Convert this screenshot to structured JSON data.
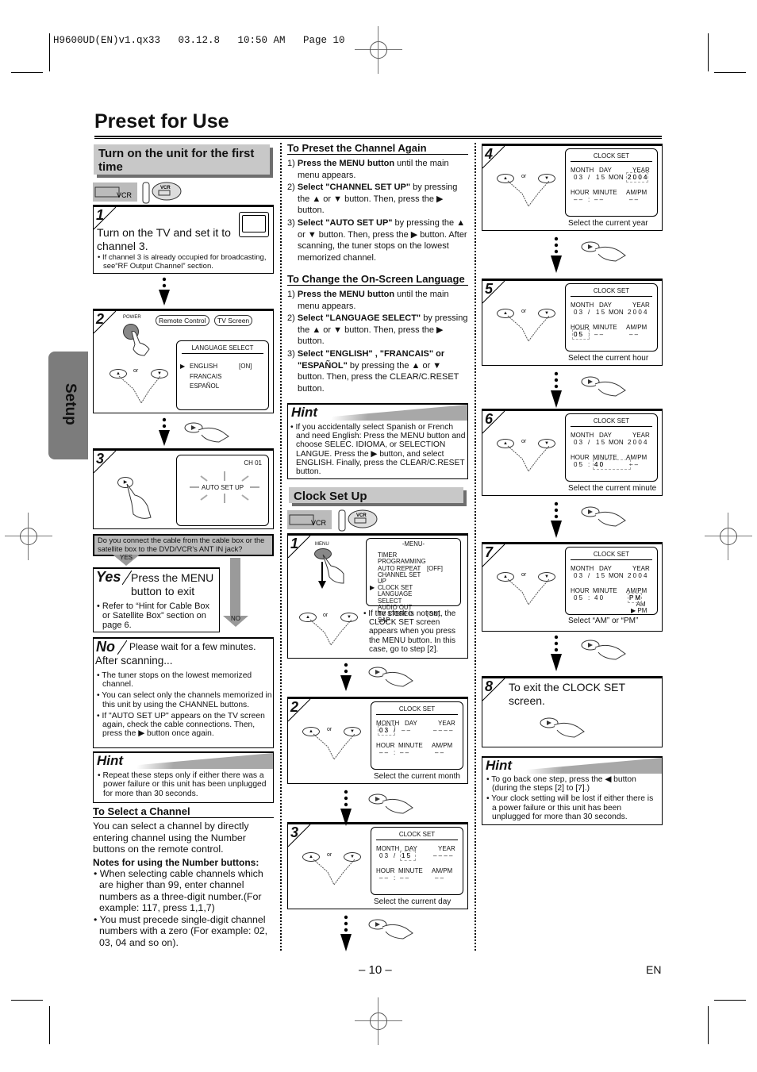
{
  "print_slug": "H9600UD(EN)v1.qx33   03.12.8   10:50 AM   Page 10",
  "page_title": "Preset for Use",
  "side_tab": "Setup",
  "left_col": {
    "section_title": "Turn on the unit for the first time",
    "mode_icons": [
      "vcr-button-icon",
      "remote-vcr-icon"
    ],
    "step1": {
      "num": "1",
      "text": "Turn on the TV and set it to channel 3.",
      "note": "If channel 3 is already occupied for broadcasting, see“RF Output Channel” section."
    },
    "step2": {
      "num": "2",
      "power_label": "POWER",
      "bubble_remote": "Remote Control",
      "bubble_tv": "TV Screen",
      "or": "or",
      "screen_title": "LANGUAGE SELECT",
      "screen_items": [
        {
          "label": "ENGLISH",
          "value": "[ON]",
          "selected": true
        },
        {
          "label": "FRANCAIS",
          "value": "",
          "selected": false
        },
        {
          "label": "ESPAÑOL",
          "value": "",
          "selected": false
        }
      ]
    },
    "step3": {
      "num": "3",
      "channel": "CH 01",
      "screen_text": "AUTO SET UP"
    },
    "question": "Do you connect the cable from the cable box or the satellite box to the DVD/VCR's ANT IN jack?",
    "yes_label": "YES",
    "no_label": "NO",
    "yes_box": {
      "head": "Yes",
      "text": "Press the MENU button to exit",
      "note": "Refer to “Hint for Cable Box or Satellite Box” section on page 6."
    },
    "no_box": {
      "head": "No",
      "text": "Please wait for a few minutes.",
      "after": "After scanning...",
      "notes": [
        "The tuner stops on the lowest memorized channel.",
        "You can select only the channels memorized in this unit by using the CHANNEL buttons.",
        "If \"AUTO SET UP\" appears on the TV screen again, check the cable connections. Then, press the ▶ button once again."
      ]
    },
    "hint": {
      "head": "Hint",
      "notes": [
        "Repeat these steps only if either there was a power failure or this unit has been unplugged for more than 30 seconds."
      ]
    },
    "select_channel": {
      "title": "To Select a Channel",
      "body": "You can select a channel by directly entering channel using the Number buttons on the remote control.",
      "notes_title": "Notes for using the Number buttons:",
      "notes": [
        "When selecting cable channels which are higher than 99, enter channel numbers as a three-digit number.(For example: 117, press 1,1,7)",
        "You must precede single-digit channel numbers with a zero (For example: 02, 03, 04 and so on)."
      ]
    }
  },
  "mid_col": {
    "preset_again": {
      "title": "To Preset the Channel Again",
      "steps": [
        {
          "n": "1)",
          "bold": "Press the MENU button",
          "rest": " until the main menu appears."
        },
        {
          "n": "2)",
          "bold": "Select \"CHANNEL SET UP\"",
          "rest": " by pressing the ▲ or ▼ button. Then, press the ▶ button."
        },
        {
          "n": "3)",
          "bold": "Select \"AUTO SET UP\"",
          "rest": " by pressing the ▲ or ▼ button. Then, press the ▶ button. After scanning, the tuner stops on the lowest memorized channel."
        }
      ]
    },
    "change_language": {
      "title": "To Change the On-Screen Language",
      "steps": [
        {
          "n": "1)",
          "bold": "Press the MENU button",
          "rest": " until the main menu appears."
        },
        {
          "n": "2)",
          "bold": "Select \"LANGUAGE SELECT\"",
          "rest": " by pressing the ▲ or ▼ button. Then, press the ▶ button."
        },
        {
          "n": "3)",
          "bold": "Select \"ENGLISH\" , \"FRANCAIS\" or \"ESPAÑOL\"",
          "rest": " by pressing the ▲ or ▼ button. Then, press the CLEAR/C.RESET button."
        }
      ]
    },
    "hint": {
      "head": "Hint",
      "notes": [
        "If you accidentally select Spanish or French and need English: Press the MENU button and choose SELEC. IDIOMA, or SELECTION LANGUE. Press the ▶ button, and select ENGLISH. Finally, press the CLEAR/C.RESET button."
      ]
    },
    "clock_title": "Clock Set Up",
    "clock_step1": {
      "num": "1",
      "menu_label": "MENU",
      "or": "or",
      "menu_title": "-MENU-",
      "menu_items": [
        {
          "label": "TIMER PROGRAMMING",
          "value": "",
          "selected": false
        },
        {
          "label": "AUTO REPEAT",
          "value": "[OFF]",
          "selected": false
        },
        {
          "label": "CHANNEL SET UP",
          "value": "",
          "selected": false
        },
        {
          "label": "CLOCK SET",
          "value": "",
          "selected": true
        },
        {
          "label": "LANGUAGE SELECT",
          "value": "",
          "selected": false
        },
        {
          "label": "AUDIO OUT",
          "value": "",
          "selected": false
        },
        {
          "label": "TV STEREO",
          "value": "[ON]",
          "selected": false
        },
        {
          "label": "SAP",
          "value": "",
          "selected": false
        }
      ],
      "note": "If the clock is not set, the CLOCK SET screen appears when you press the MENU button. In this case, go to step [2]."
    }
  },
  "clock_steps": [
    {
      "num": "2",
      "month": "0 3",
      "day": "– –",
      "dow": "",
      "year": "– – – –",
      "hour": "– –",
      "minute": "– –",
      "ampm": "– –",
      "blink": "month",
      "caption": "Select the current month"
    },
    {
      "num": "3",
      "month": "0 3",
      "day": "1 5",
      "dow": "",
      "year": "– – – –",
      "hour": "– –",
      "minute": "– –",
      "ampm": "– –",
      "blink": "day",
      "caption": "Select the current day"
    },
    {
      "num": "4",
      "month": "0 3",
      "day": "1 5",
      "dow": "MON",
      "year": "2 0 0 4",
      "hour": "– –",
      "minute": "– –",
      "ampm": "– –",
      "blink": "year",
      "caption": "Select the current year"
    },
    {
      "num": "5",
      "month": "0 3",
      "day": "1 5",
      "dow": "MON",
      "year": "2 0 0 4",
      "hour": "0 5",
      "minute": "– –",
      "ampm": "– –",
      "blink": "hour",
      "caption": "Select the current hour"
    },
    {
      "num": "6",
      "month": "0 3",
      "day": "1 5",
      "dow": "MON",
      "year": "2 0 0 4",
      "hour": "0 5",
      "minute": "4 0",
      "ampm": "– –",
      "blink": "minute",
      "caption": "Select the current minute"
    },
    {
      "num": "7",
      "month": "0 3",
      "day": "1 5",
      "dow": "MON",
      "year": "2 0 0 4",
      "hour": "0 5",
      "minute": "4 0",
      "ampm": "P M",
      "ampm_opts": [
        "AM",
        "PM"
      ],
      "blink": "ampm",
      "caption": "Select “AM” or “PM”"
    }
  ],
  "clock_labels": {
    "title": "CLOCK SET",
    "month": "MONTH",
    "day": "DAY",
    "year": "YEAR",
    "hour": "HOUR",
    "minute": "MINUTE",
    "ampm": "AM/PM",
    "or": "or"
  },
  "right_col": {
    "step8": {
      "num": "8",
      "text": "To exit the CLOCK SET screen."
    },
    "hint": {
      "head": "Hint",
      "notes": [
        "To go back one step, press the ◀ button (during the steps [2] to [7].)",
        "Your clock setting will be lost if either there is a power failure or this unit has been unplugged for more than 30 seconds."
      ]
    }
  },
  "footer": {
    "page_number": "– 10 –",
    "language": "EN"
  }
}
